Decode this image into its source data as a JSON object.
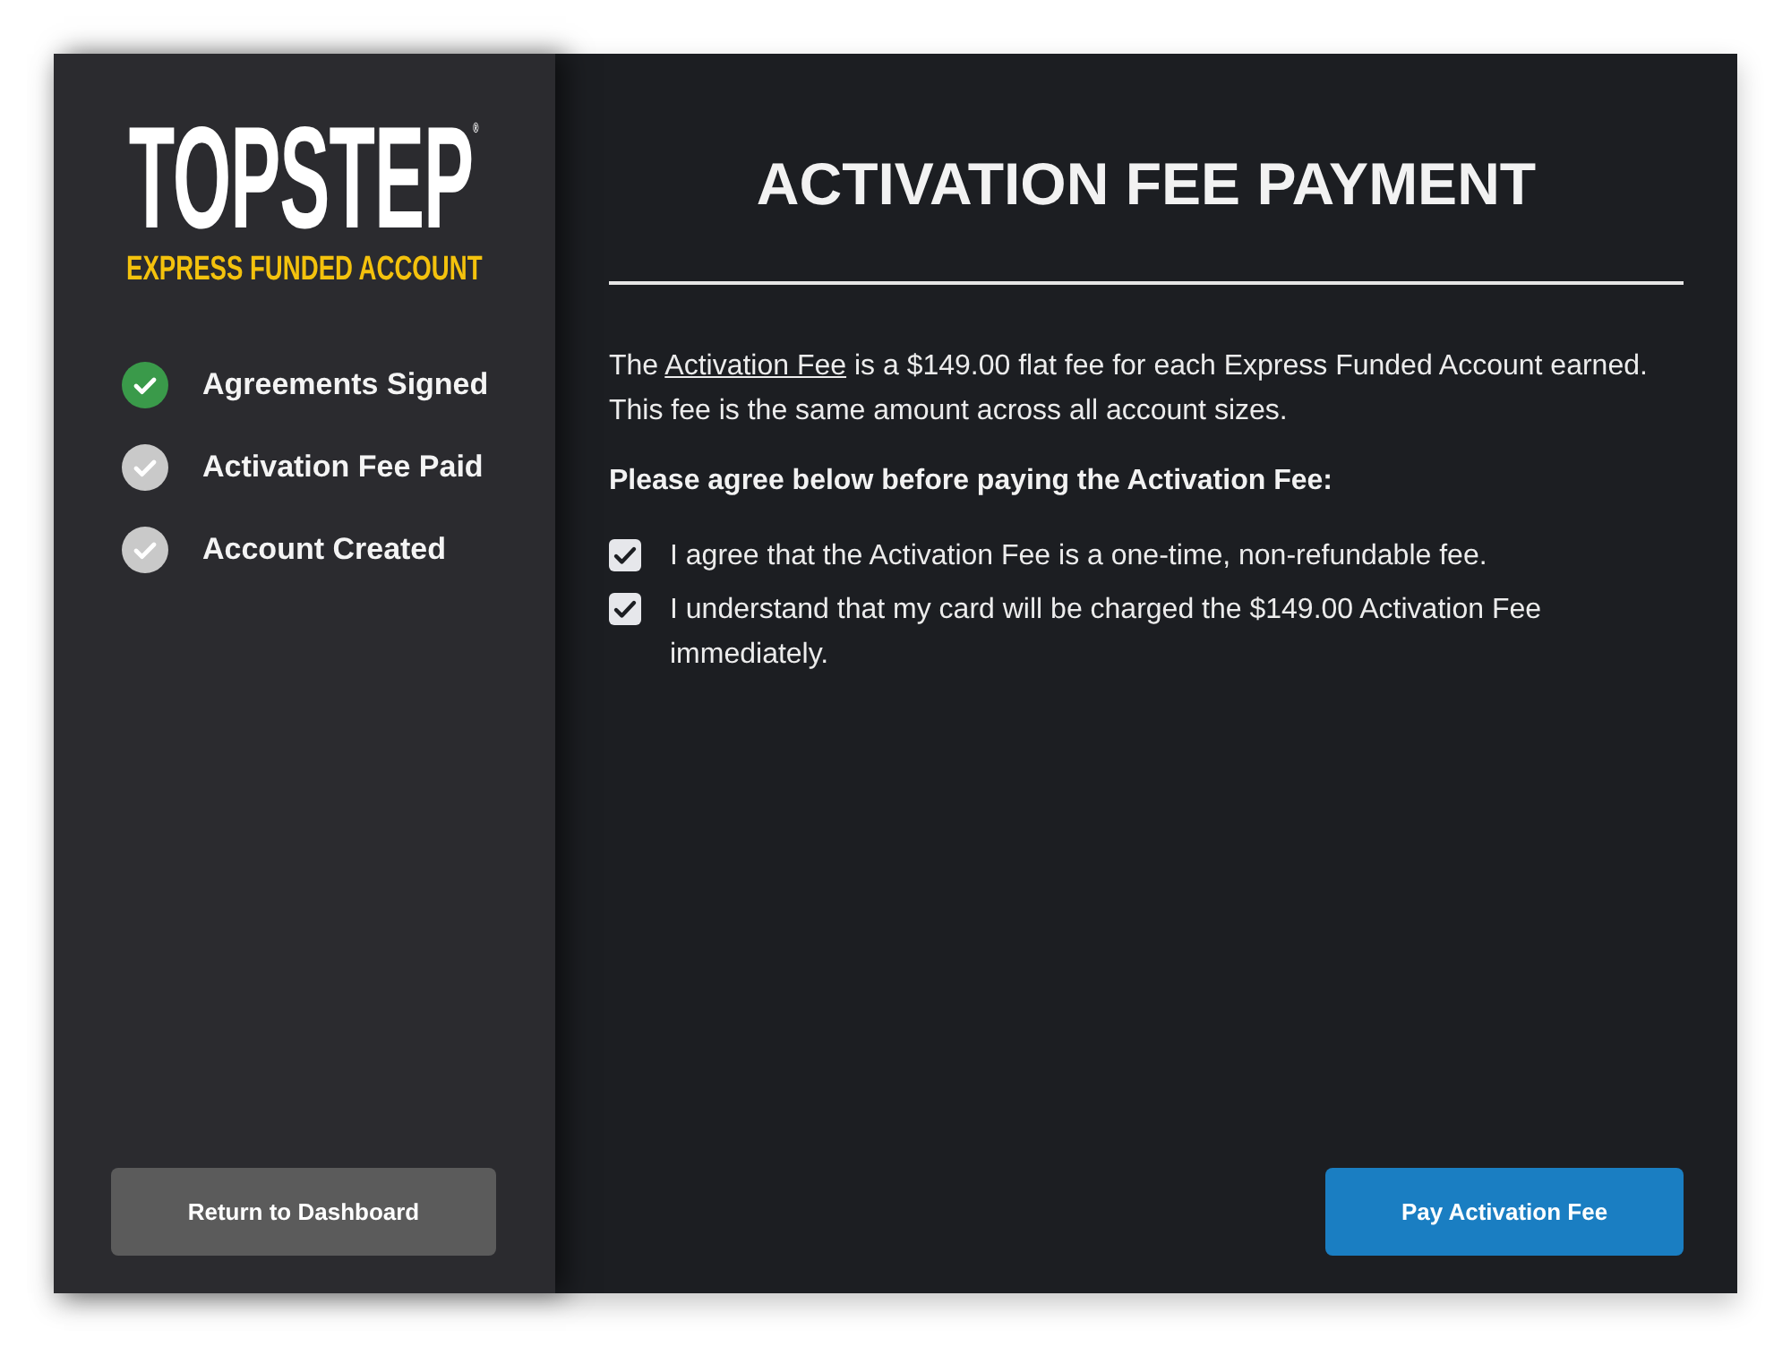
{
  "sidebar": {
    "logo": {
      "wordmark": "TOPSTEP$^{®}$",
      "tagline": "EXPRESS FUNDED ACCOUNT"
    },
    "steps": [
      {
        "label": "Agreements Signed",
        "completed": true
      },
      {
        "label": "Activation Fee Paid",
        "completed": false
      },
      {
        "label": "Account Created",
        "completed": false
      }
    ],
    "return_button": "Return to Dashboard"
  },
  "main": {
    "title": "ACTIVATION FEE PAYMENT",
    "intro": {
      "before": "The ",
      "link": "Activation Fee",
      "after": " is a $149.00 flat fee for each Express Funded Account earned. This fee is the same amount across all account sizes."
    },
    "agree_prompt": "Please agree below before paying the Activation Fee:",
    "agreements": [
      {
        "label": "I agree that the Activation Fee is a one-time, non-refundable fee.",
        "checked": true
      },
      {
        "label": "I understand that my card will be charged the $149.00 Activation Fee immediately.",
        "checked": true
      }
    ],
    "pay_button": "Pay Activation Fee"
  }
}
